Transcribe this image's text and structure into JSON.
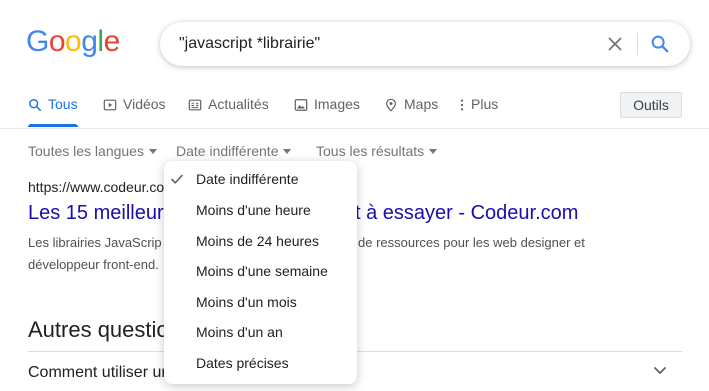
{
  "logo": {
    "letters": [
      "G",
      "o",
      "o",
      "g",
      "l",
      "e"
    ],
    "colors": [
      "#4285F4",
      "#EA4335",
      "#FBBC05",
      "#4285F4",
      "#34A853",
      "#EA4335"
    ]
  },
  "search": {
    "query": "\"javascript *librairie\""
  },
  "tabs": [
    {
      "label": "Tous",
      "icon": "search-icon"
    },
    {
      "label": "Vidéos",
      "icon": "video-icon"
    },
    {
      "label": "Actualités",
      "icon": "news-icon"
    },
    {
      "label": "Images",
      "icon": "image-icon"
    },
    {
      "label": "Maps",
      "icon": "map-pin-icon"
    },
    {
      "label": "Plus",
      "icon": "more-vert-icon"
    }
  ],
  "tools_label": "Outils",
  "filters": [
    "Toutes les langues",
    "Date indifférente",
    "Tous les résultats"
  ],
  "result": {
    "url": "https://www.codeur.con",
    "title_left": "Les 15 meilleure",
    "title_right": "t à essayer - Codeur.com",
    "snippet_line1": "Les librairies JavaScrip",
    "snippet_line1_right": "de ressources pour les web designer et",
    "snippet_line2": "développeur front-end."
  },
  "people_also_ask": {
    "heading": "Autres questio",
    "question": "Comment utiliser ur"
  },
  "menu": {
    "items": [
      "Date indifférente",
      "Moins d'une heure",
      "Moins de 24 heures",
      "Moins d'une semaine",
      "Moins d'un mois",
      "Moins d'un an",
      "Dates précises"
    ],
    "selected": "Date indifférente"
  },
  "colors": {
    "accent": "#1a73e8",
    "link": "#1a0dab"
  }
}
